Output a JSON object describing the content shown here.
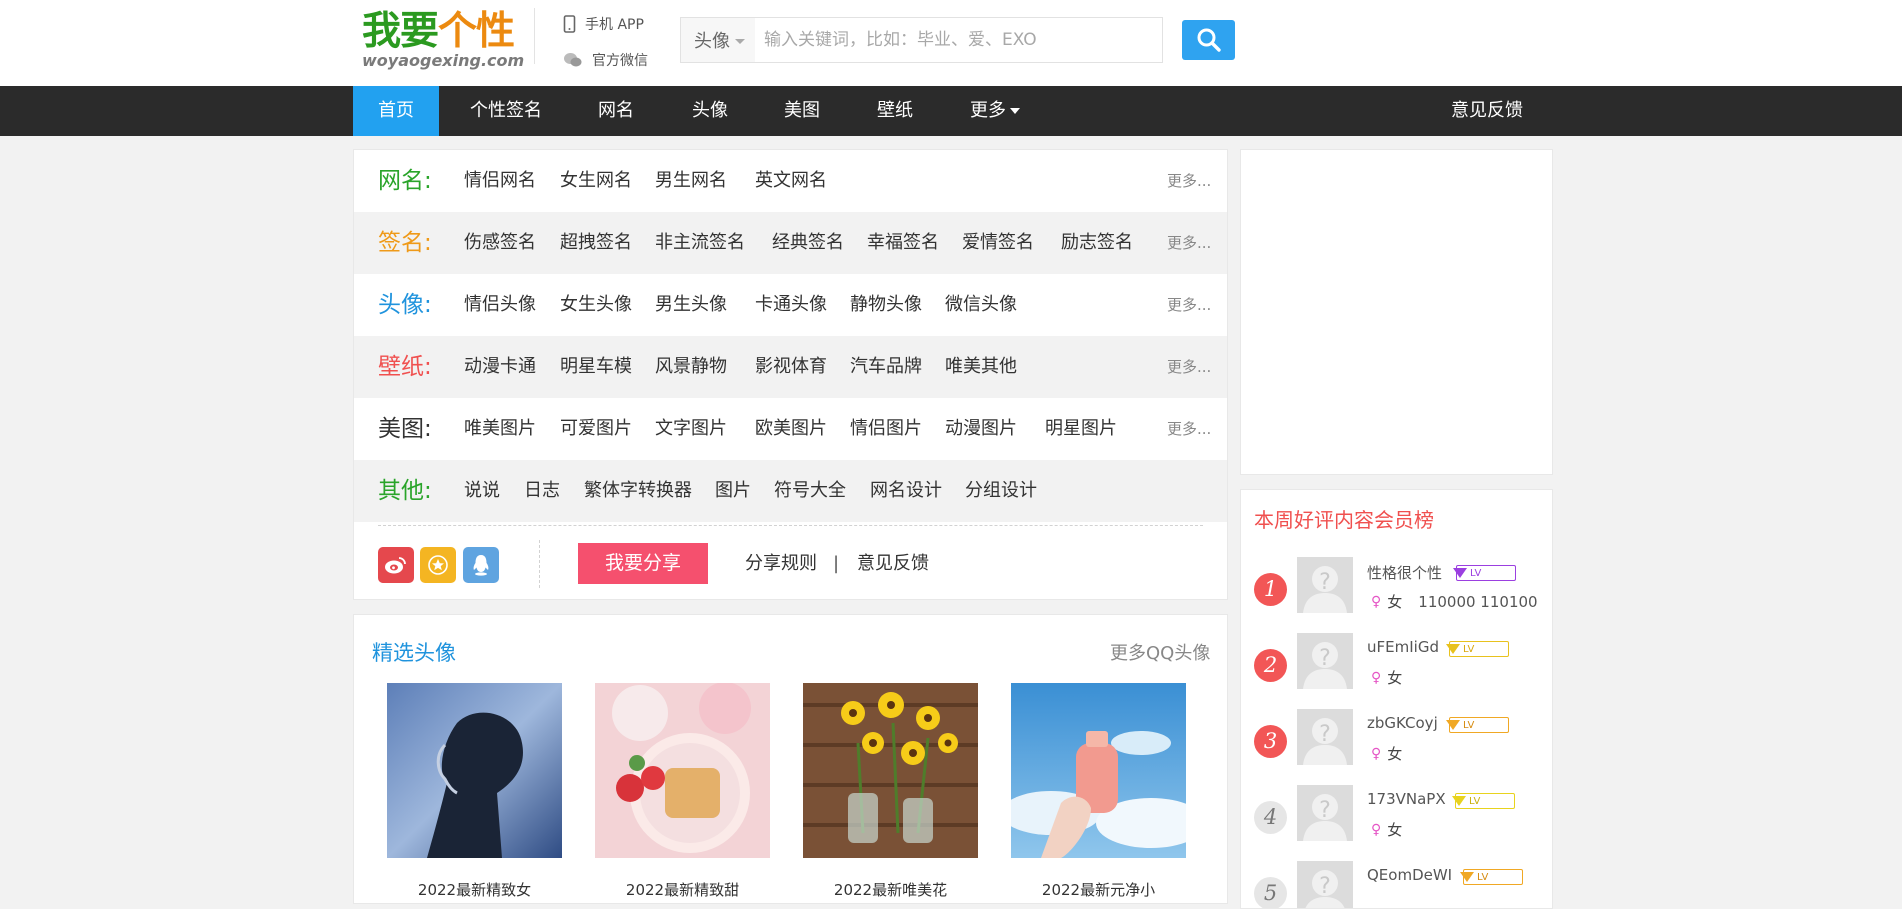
{
  "header": {
    "logo_cn_a": "我要",
    "logo_cn_b": "个性",
    "logo_en": "woyaogexing.com",
    "mobile_app": "手机 APP",
    "wechat": "官方微信",
    "search": {
      "category": "头像",
      "placeholder": "输入关键词，比如：毕业、爱、EXO"
    }
  },
  "nav": {
    "items": [
      "首页",
      "个性签名",
      "网名",
      "头像",
      "美图",
      "壁纸",
      "更多"
    ],
    "feedback": "意见反馈"
  },
  "categories": [
    {
      "label": "网名:",
      "color": "#2aa42a",
      "links": [
        "情侣网名",
        "女生网名",
        "男生网名",
        "英文网名"
      ],
      "more": "更多..."
    },
    {
      "label": "签名:",
      "color": "#ef9a19",
      "links": [
        "伤感签名",
        "超拽签名",
        "非主流签名",
        "经典签名",
        "幸福签名",
        "爱情签名",
        "励志签名"
      ],
      "more": "更多..."
    },
    {
      "label": "头像:",
      "color": "#1f93dd",
      "links": [
        "情侣头像",
        "女生头像",
        "男生头像",
        "卡通头像",
        "静物头像",
        "微信头像"
      ],
      "more": "更多..."
    },
    {
      "label": "壁纸:",
      "color": "#f0504f",
      "links": [
        "动漫卡通",
        "明星车模",
        "风景静物",
        "影视体育",
        "汽车品牌",
        "唯美其他"
      ],
      "more": "更多..."
    },
    {
      "label": "美图:",
      "color": "#333333",
      "links": [
        "唯美图片",
        "可爱图片",
        "文字图片",
        "欧美图片",
        "情侣图片",
        "动漫图片",
        "明星图片"
      ],
      "more": "更多..."
    },
    {
      "label": "其他:",
      "color": "#2aa42a",
      "links": [
        "说说",
        "日志",
        "繁体字转换器",
        "图片",
        "符号大全",
        "网名设计",
        "分组设计"
      ],
      "more": ""
    }
  ],
  "share": {
    "button": "我要分享",
    "rules": "分享规则",
    "sep": "|",
    "feedback": "意见反馈"
  },
  "featured": {
    "title": "精选头像",
    "more": "更多QQ头像",
    "items": [
      {
        "caption": "2022最新精致女"
      },
      {
        "caption": "2022最新精致甜"
      },
      {
        "caption": "2022最新唯美花"
      },
      {
        "caption": "2022最新元净小"
      }
    ]
  },
  "ranking": {
    "title": "本周好评内容会员榜",
    "badge_text": "LV",
    "users": [
      {
        "rank": "1",
        "name": "性格很个性",
        "sex": "女",
        "stats": "110000 110100",
        "badge_color": "#9b3fe0"
      },
      {
        "rank": "2",
        "name": "uFEmIiGd",
        "sex": "女",
        "stats": "",
        "badge_color": "#e8c21e"
      },
      {
        "rank": "3",
        "name": "zbGKCoyj",
        "sex": "女",
        "stats": "",
        "badge_color": "#f0a824"
      },
      {
        "rank": "4",
        "name": "173VNaPX",
        "sex": "女",
        "stats": "",
        "badge_color": "#e8d31e"
      },
      {
        "rank": "5",
        "name": "QEomDeWI",
        "sex": "",
        "stats": "",
        "badge_color": "#f0a824"
      }
    ]
  }
}
